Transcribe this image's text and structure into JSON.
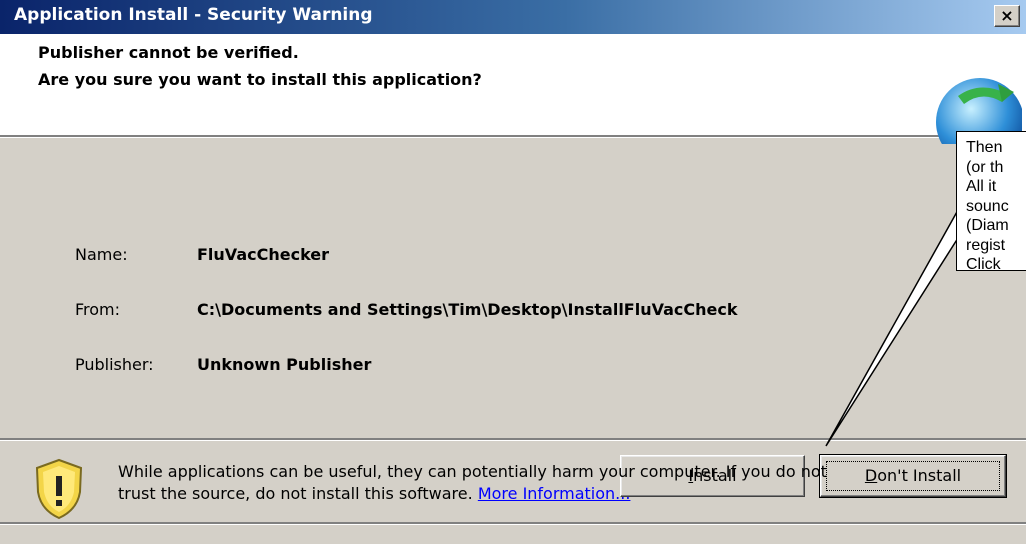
{
  "window": {
    "title": "Application Install - Security Warning",
    "close_glyph": "×"
  },
  "header": {
    "line1": "Publisher cannot be verified.",
    "line2": "Are you sure you want to install this application?",
    "icon": "globe-icon"
  },
  "details": {
    "name_label": "Name:",
    "name_value": "FluVacChecker",
    "from_label": "From:",
    "from_value": "C:\\Documents and Settings\\Tim\\Desktop\\InstallFluVacCheck",
    "publisher_label": "Publisher:",
    "publisher_value": "Unknown Publisher"
  },
  "buttons": {
    "install_first": "I",
    "install_rest": "nstall",
    "dont_first": "D",
    "dont_rest": "on't Install"
  },
  "warning": {
    "icon": "shield-warning-icon",
    "text_line1": "While applications can be useful, they can potentially harm your computer. If you do not",
    "text_line2": "trust the source, do not install this software.",
    "link": "More Information..."
  },
  "callout": {
    "lines": [
      "Then",
      "(or th",
      "All it",
      "sounc",
      "(Diam",
      "regist",
      "Click"
    ]
  },
  "colors": {
    "titlebar_start": "#0a246a",
    "titlebar_end": "#a6caf0",
    "dialog_bg": "#d4d0c8",
    "link": "#0000ff"
  }
}
